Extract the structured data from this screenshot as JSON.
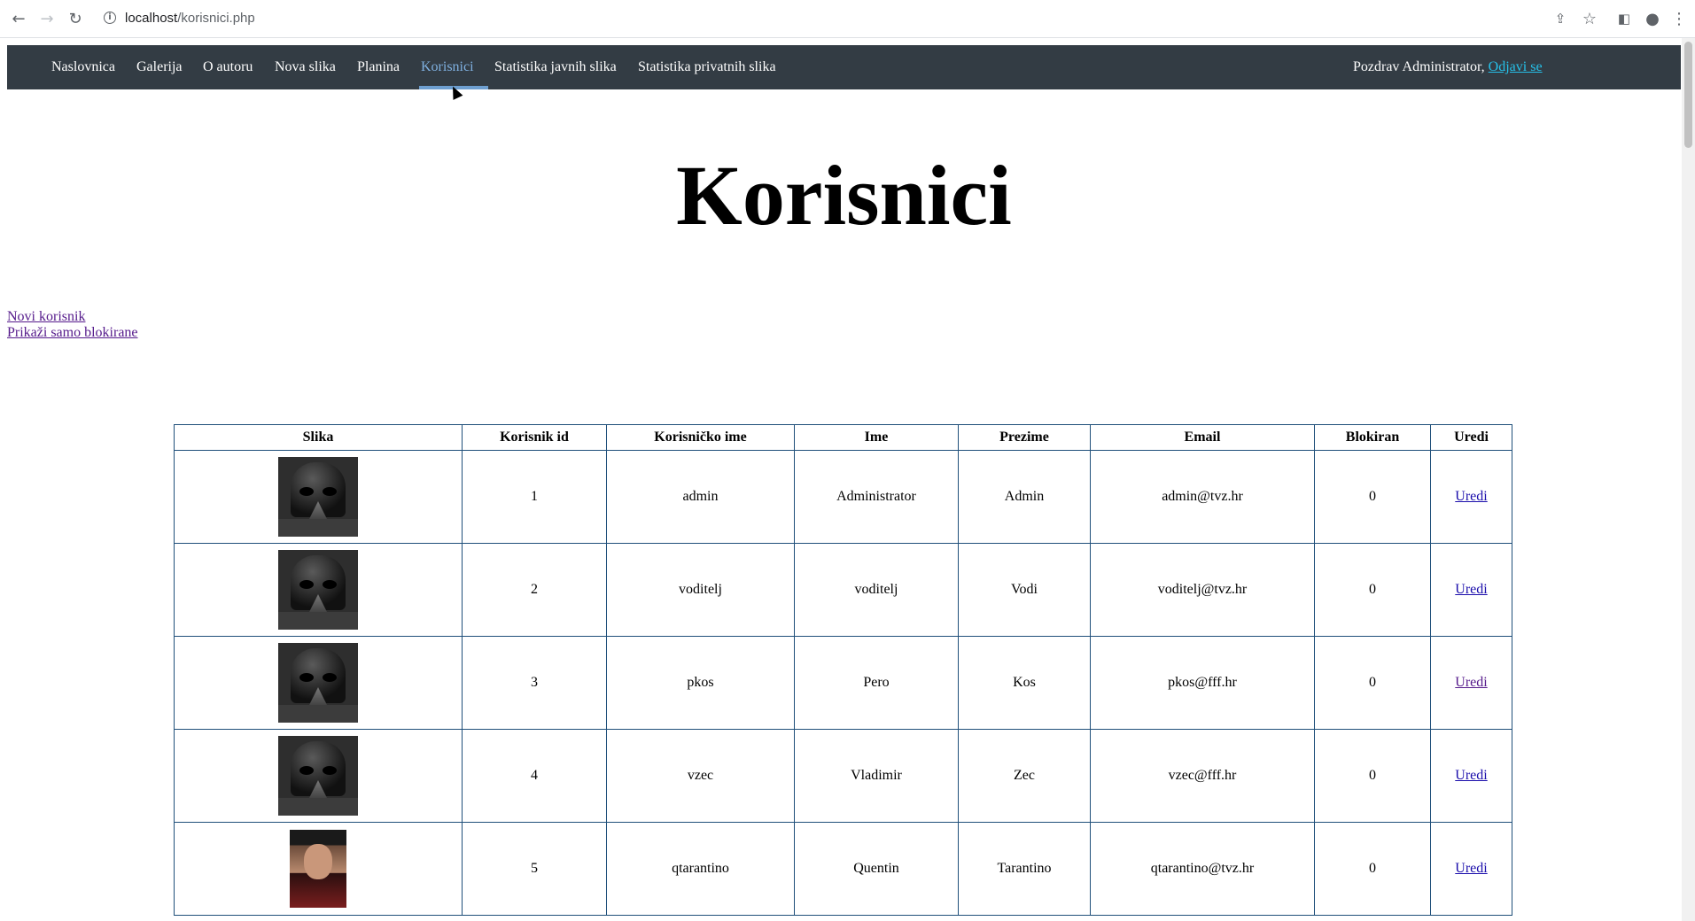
{
  "browser": {
    "url_host": "localhost",
    "url_path": "/korisnici.php"
  },
  "nav": {
    "items": [
      {
        "label": "Naslovnica"
      },
      {
        "label": "Galerija"
      },
      {
        "label": "O autoru"
      },
      {
        "label": "Nova slika"
      },
      {
        "label": "Planina"
      },
      {
        "label": "Korisnici"
      },
      {
        "label": "Statistika javnih slika"
      },
      {
        "label": "Statistika privatnih slika"
      }
    ],
    "active": "Korisnici",
    "greeting": "Pozdrav Administrator, ",
    "logout_label": "Odjavi se"
  },
  "page": {
    "title": "Korisnici",
    "new_user_link": "Novi korisnik",
    "blocked_only_link": "Prikaži samo blokirane"
  },
  "table": {
    "headers": [
      "Slika",
      "Korisnik id",
      "Korisničko ime",
      "Ime",
      "Prezime",
      "Email",
      "Blokiran",
      "Uredi"
    ],
    "rows": [
      {
        "image": "vader-avatar",
        "id": "1",
        "username": "admin",
        "first": "Administrator",
        "last": "Admin",
        "email": "admin@tvz.hr",
        "blocked": "0",
        "edit": "Uredi"
      },
      {
        "image": "vader-avatar",
        "id": "2",
        "username": "voditelj",
        "first": "voditelj",
        "last": "Vodi",
        "email": "voditelj@tvz.hr",
        "blocked": "0",
        "edit": "Uredi"
      },
      {
        "image": "vader-avatar",
        "id": "3",
        "username": "pkos",
        "first": "Pero",
        "last": "Kos",
        "email": "pkos@fff.hr",
        "blocked": "0",
        "edit": "Uredi"
      },
      {
        "image": "vader-avatar",
        "id": "4",
        "username": "vzec",
        "first": "Vladimir",
        "last": "Zec",
        "email": "vzec@fff.hr",
        "blocked": "0",
        "edit": "Uredi"
      },
      {
        "image": "portrait-photo",
        "id": "5",
        "username": "qtarantino",
        "first": "Quentin",
        "last": "Tarantino",
        "email": "qtarantino@tvz.hr",
        "blocked": "0",
        "edit": "Uredi"
      }
    ]
  }
}
